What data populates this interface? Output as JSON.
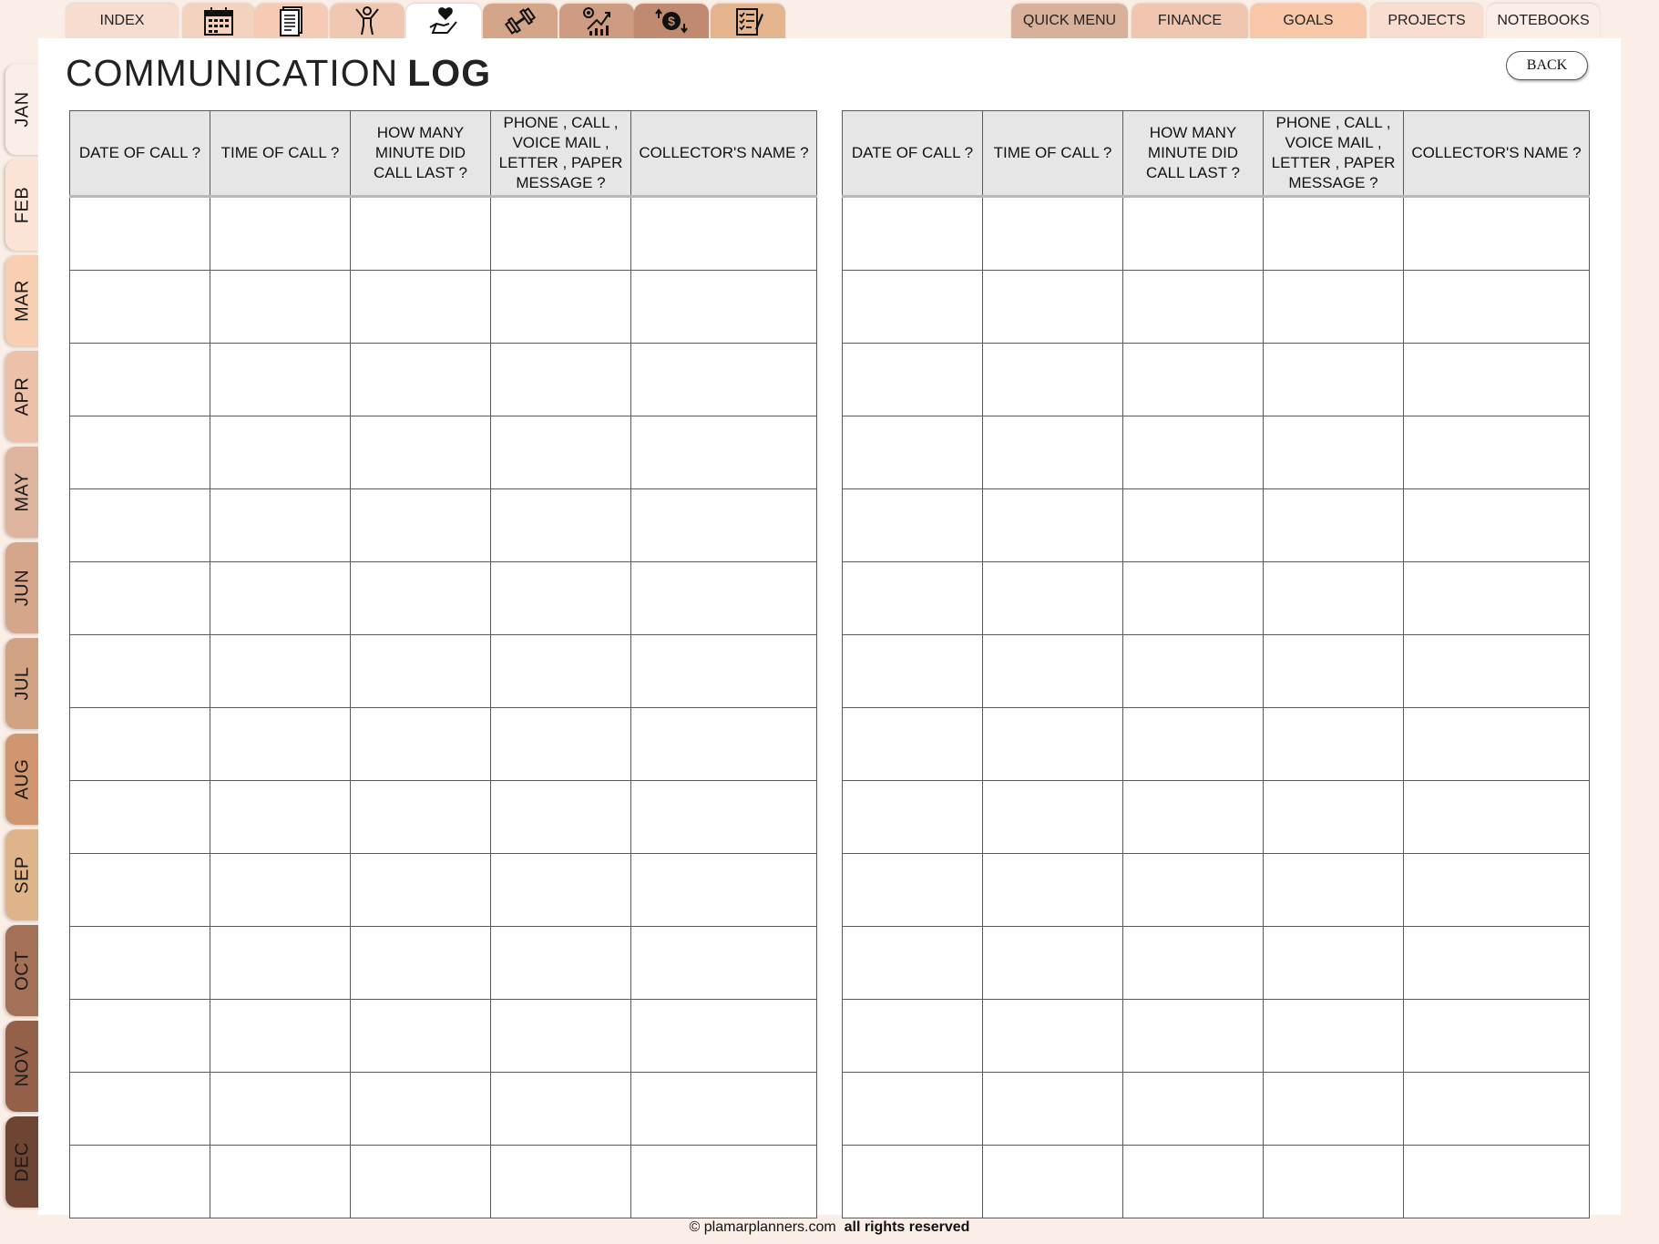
{
  "top_tabs": [
    {
      "label": "INDEX"
    },
    {
      "icon": "calendar-icon"
    },
    {
      "icon": "document-icon"
    },
    {
      "icon": "person-icon"
    },
    {
      "icon": "heart-hand-icon"
    },
    {
      "icon": "dumbbell-icon"
    },
    {
      "icon": "growth-chart-icon"
    },
    {
      "icon": "money-exchange-icon"
    },
    {
      "icon": "checklist-icon"
    }
  ],
  "right_tabs": [
    {
      "label": "QUICK MENU"
    },
    {
      "label": "FINANCE"
    },
    {
      "label": "GOALS"
    },
    {
      "label": "PROJECTS"
    },
    {
      "label": "NOTEBOOKS"
    }
  ],
  "months": [
    "JAN",
    "FEB",
    "MAR",
    "APR",
    "MAY",
    "JUN",
    "JUL",
    "AUG",
    "SEP",
    "OCT",
    "NOV",
    "DEC"
  ],
  "title": {
    "light": "COMMUNICATION",
    "bold": "LOG"
  },
  "back_label": "BACK",
  "log_columns": [
    "DATE OF CALL ?",
    "TIME OF CALL ?",
    "HOW MANY MINUTE DID CALL LAST ?",
    "PHONE , CALL , VOICE MAIL , LETTER , PAPER MESSAGE ?",
    "COLLECTOR'S NAME ?"
  ],
  "footer": {
    "site": "© plamarplanners.com",
    "rights": "all rights reserved"
  },
  "colors": {
    "background": "#faeee6",
    "header_fill": "#e6e6e6",
    "grid_line": "#5a5a5a"
  }
}
